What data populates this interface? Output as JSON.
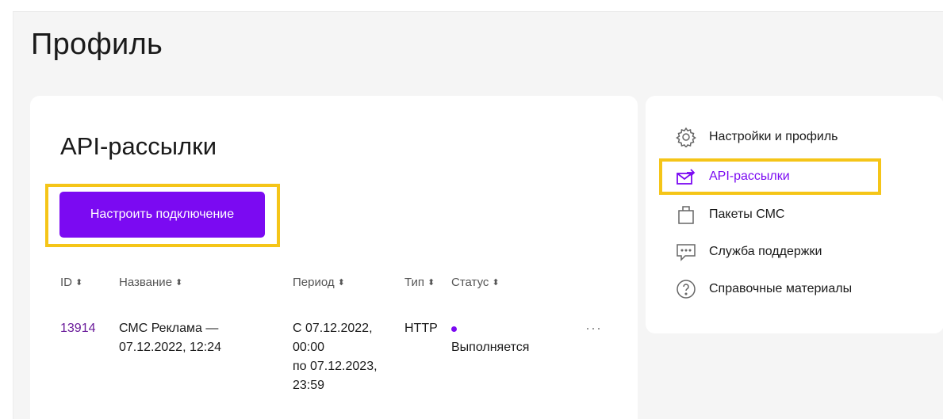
{
  "page": {
    "title": "Профиль"
  },
  "main": {
    "section_title": "API-рассылки",
    "connect_button_label": "Настроить подключение",
    "table": {
      "headers": [
        "ID",
        "Название",
        "Период",
        "Тип",
        "Статус"
      ],
      "rows": [
        {
          "id": "13914",
          "name_line1": "СМС Реклама —",
          "name_line2": "07.12.2022, 12:24",
          "period_line1": "С 07.12.2022,",
          "period_line2": "00:00",
          "period_line3": "по 07.12.2023,",
          "period_line4": "23:59",
          "type": "HTTP",
          "status": "Выполняется",
          "more": "···"
        }
      ]
    }
  },
  "sidebar": {
    "items": [
      {
        "label": "Настройки и профиль",
        "icon": "gear-icon"
      },
      {
        "label": "API-рассылки",
        "icon": "api-mail-icon",
        "active": true
      },
      {
        "label": "Пакеты СМС",
        "icon": "bag-icon"
      },
      {
        "label": "Служба поддержки",
        "icon": "chat-icon"
      },
      {
        "label": "Справочные материалы",
        "icon": "help-icon"
      }
    ]
  },
  "colors": {
    "accent": "#7b0af2",
    "highlight": "#f5c518",
    "id_link": "#6a1b9a"
  }
}
